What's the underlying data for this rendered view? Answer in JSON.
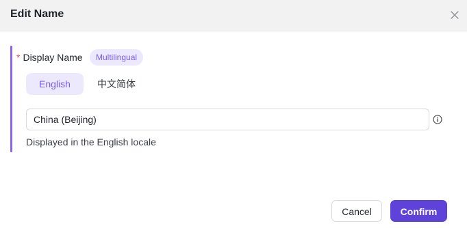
{
  "dialog": {
    "title": "Edit Name",
    "close_icon": "close-icon"
  },
  "field": {
    "required_mark": "*",
    "label": "Display Name",
    "badge": "Multilingual"
  },
  "tabs": [
    {
      "label": "English",
      "active": true
    },
    {
      "label": "中文简体",
      "active": false
    }
  ],
  "input": {
    "value": "China (Beijing)",
    "info_icon": "info-circle-icon"
  },
  "helper_text": "Displayed in the English locale",
  "footer": {
    "cancel_label": "Cancel",
    "confirm_label": "Confirm"
  },
  "colors": {
    "accent": "#8a63f0",
    "primary_button": "#5e42da",
    "required": "#e34d59",
    "tab_active_bg": "#ede9fc"
  }
}
